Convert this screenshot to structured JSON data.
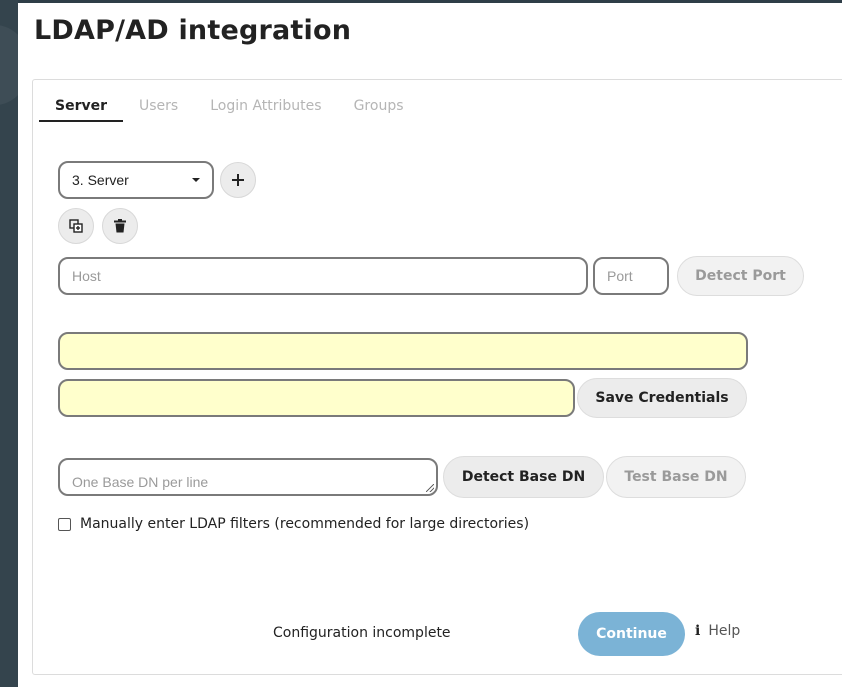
{
  "page": {
    "title": "LDAP/AD integration"
  },
  "tabs": [
    {
      "label": "Server",
      "active": true
    },
    {
      "label": "Users",
      "active": false
    },
    {
      "label": "Login Attributes",
      "active": false
    },
    {
      "label": "Groups",
      "active": false
    }
  ],
  "server_select": {
    "value": "3. Server",
    "icon": "caret-down-icon"
  },
  "actions": {
    "add_icon": "plus-icon",
    "copy_icon": "copy-config-icon",
    "delete_icon": "trash-icon"
  },
  "host": {
    "placeholder": "Host",
    "value": ""
  },
  "port": {
    "placeholder": "Port",
    "value": ""
  },
  "buttons": {
    "detect_port": "Detect Port",
    "save_credentials": "Save Credentials",
    "detect_base_dn": "Detect Base DN",
    "test_base_dn": "Test Base DN",
    "continue": "Continue"
  },
  "credentials": {
    "user_dn_value": "",
    "password_value": "",
    "highlight_color": "#ffffcc"
  },
  "base_dn": {
    "placeholder": "One Base DN per line"
  },
  "manual_filters": {
    "label": "Manually enter LDAP filters (recommended for large directories)",
    "checked": false
  },
  "footer": {
    "status": "Configuration incomplete",
    "help_label": "Help",
    "help_icon_glyph": "i",
    "continue_color": "#7bb3d6"
  }
}
